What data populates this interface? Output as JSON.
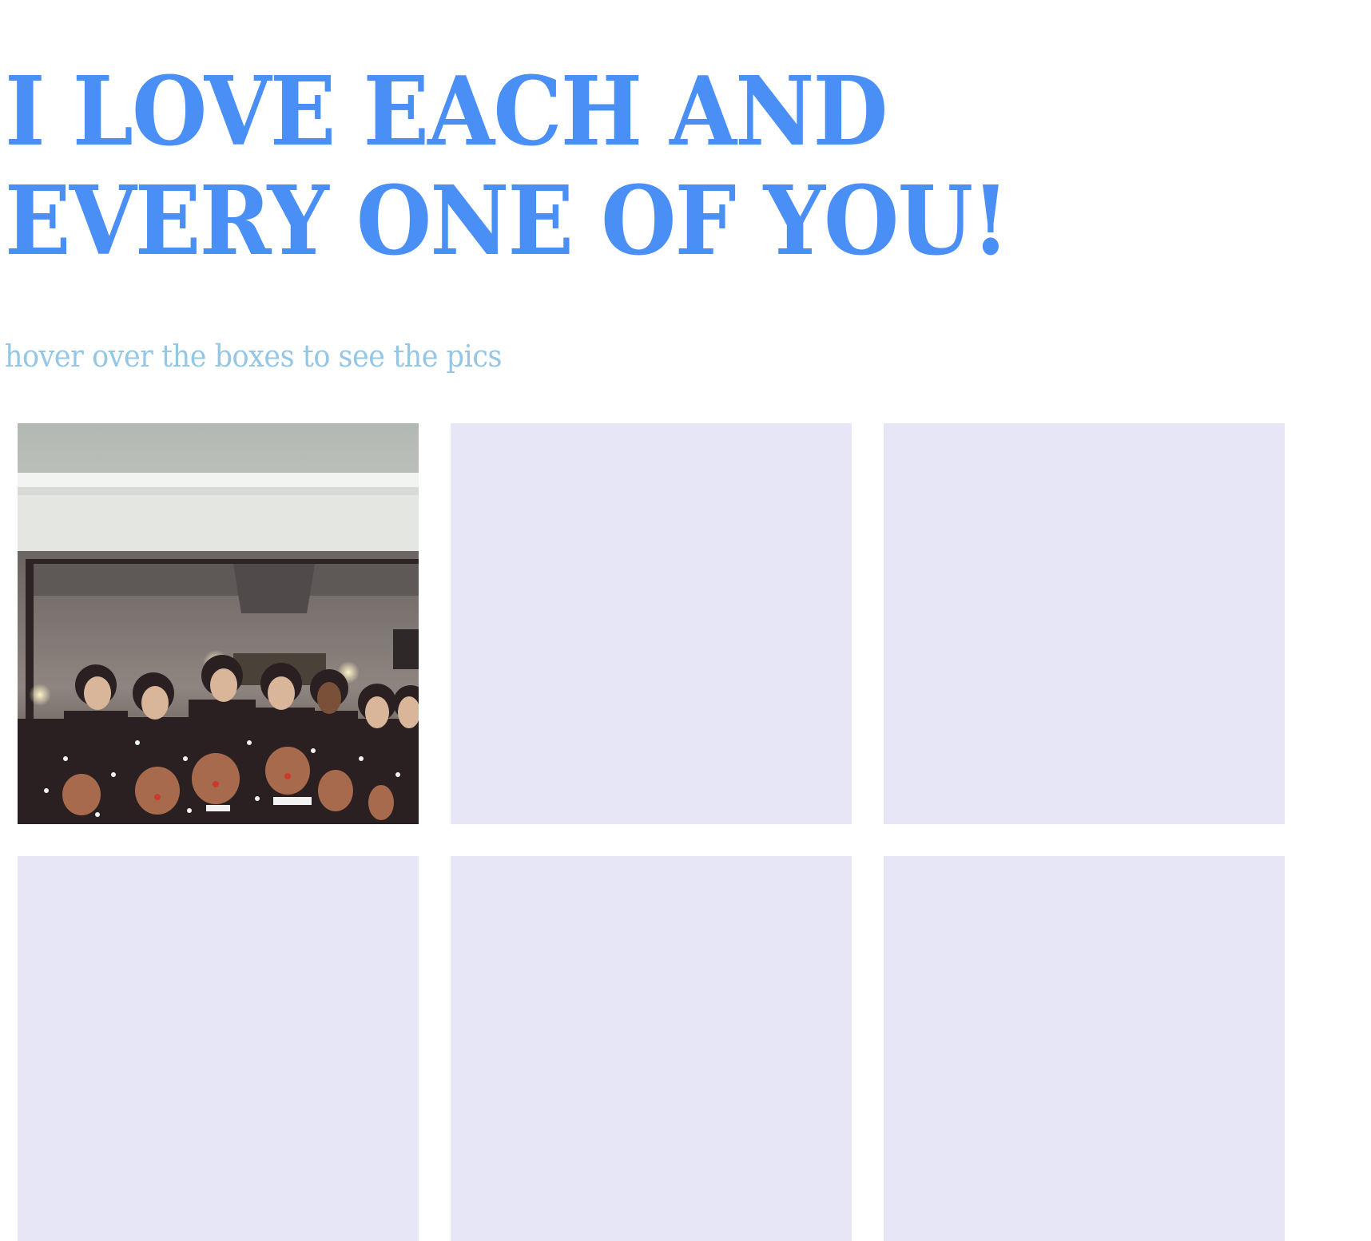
{
  "header": {
    "title": "I LOVE EACH AND EVERY ONE OF YOU!",
    "subtitle": "hover over the boxes to see the pics"
  },
  "colors": {
    "title": "#4a8ff5",
    "subtitle": "#94c6e6",
    "box_background": "#e6e6f7"
  },
  "grid": {
    "boxes": [
      {
        "revealed": true
      },
      {
        "revealed": false
      },
      {
        "revealed": false
      },
      {
        "revealed": false
      },
      {
        "revealed": false
      },
      {
        "revealed": false
      }
    ]
  }
}
